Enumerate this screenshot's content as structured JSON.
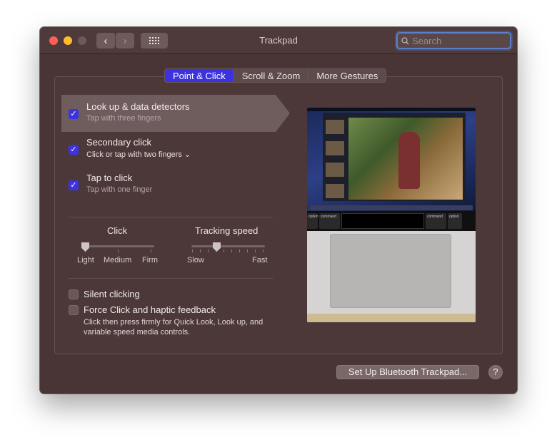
{
  "window": {
    "title": "Trackpad",
    "search_placeholder": "Search"
  },
  "nav": {
    "back_glyph": "‹",
    "forward_glyph": "›"
  },
  "tabs": [
    {
      "label": "Point & Click",
      "active": true
    },
    {
      "label": "Scroll & Zoom",
      "active": false
    },
    {
      "label": "More Gestures",
      "active": false
    }
  ],
  "gestures": [
    {
      "title": "Look up & data detectors",
      "subtitle": "Tap with three fingers",
      "checked": true,
      "selected": true
    },
    {
      "title": "Secondary click",
      "subtitle": "Click or tap with two fingers ⌄",
      "checked": true,
      "selected": false
    },
    {
      "title": "Tap to click",
      "subtitle": "Tap with one finger",
      "checked": true,
      "selected": false
    }
  ],
  "click_slider": {
    "title": "Click",
    "labels": [
      "Light",
      "Medium",
      "Firm"
    ],
    "value": "Light"
  },
  "tracking_slider": {
    "title": "Tracking speed",
    "min_label": "Slow",
    "max_label": "Fast",
    "value_fraction": 0.33
  },
  "options": {
    "silent_clicking": {
      "label": "Silent clicking",
      "checked": false
    },
    "force_click": {
      "label": "Force Click and haptic feedback",
      "checked": false,
      "description": "Click then press firmly for Quick Look, Look up, and variable speed media controls."
    }
  },
  "preview": {
    "touchbar_keys": [
      "option",
      "command",
      "command",
      "option"
    ]
  },
  "footer": {
    "bluetooth_button": "Set Up Bluetooth Trackpad...",
    "help_glyph": "?"
  },
  "colors": {
    "accent": "#3c32e0",
    "window_bg": "#4a3536",
    "close": "#ff5f57",
    "minimize": "#febc2e"
  },
  "icons": {
    "checkmark": "checkmark-icon",
    "search": "search-icon",
    "grid": "show-all-icon"
  }
}
